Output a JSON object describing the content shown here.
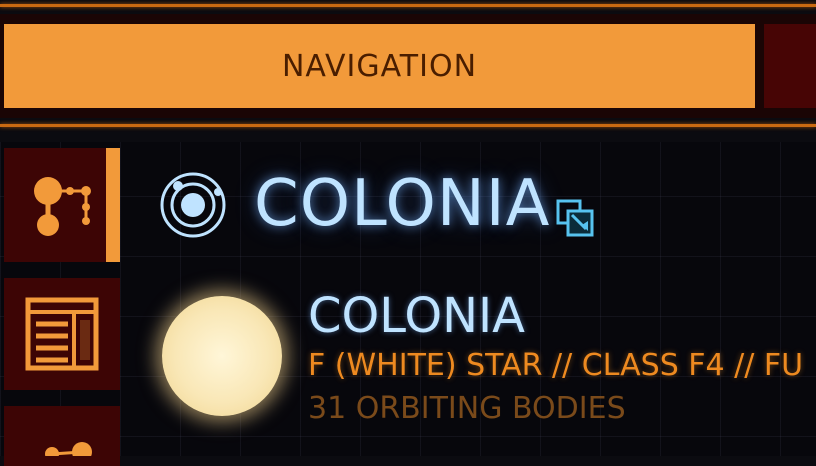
{
  "header": {
    "active_tab": "NAVIGATION"
  },
  "sidebar": {
    "items": [
      {
        "icon": "system-map-icon",
        "active": true
      },
      {
        "icon": "list-panel-icon",
        "active": false
      },
      {
        "icon": "nodes-icon",
        "active": false
      }
    ]
  },
  "system": {
    "name": "COLONIA",
    "icon": "orbit-system-icon",
    "link_icon": "open-link-icon"
  },
  "body": {
    "name": "COLONIA",
    "classification": "F (WHITE) STAR // CLASS F4 // FU",
    "orbiting": "31 ORBITING BODIES"
  },
  "colors": {
    "accent_orange": "#f29a3a",
    "text_blue": "#bfe3ff",
    "dark_red": "#3d0505"
  }
}
